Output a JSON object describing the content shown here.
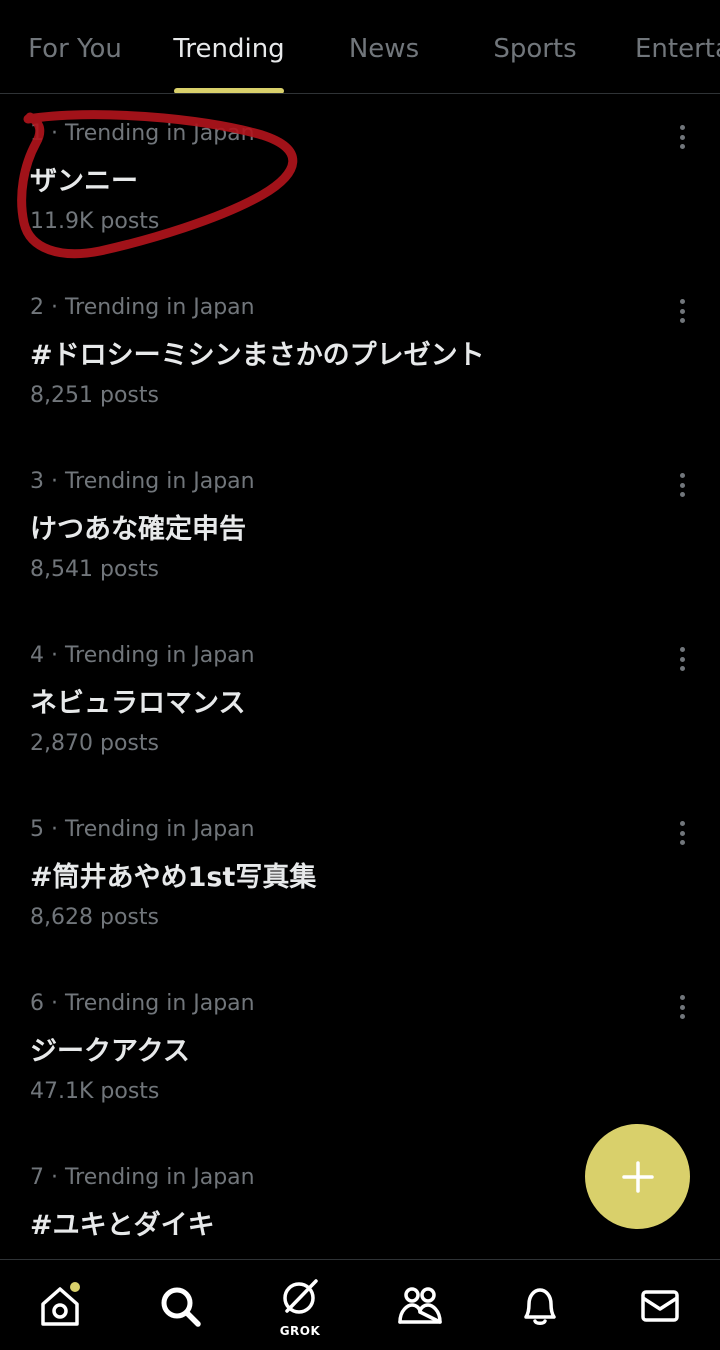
{
  "tabs": [
    {
      "label": "For You",
      "active": false
    },
    {
      "label": "Trending",
      "active": true
    },
    {
      "label": "News",
      "active": false
    },
    {
      "label": "Sports",
      "active": false
    },
    {
      "label": "Entertainment",
      "active": false
    }
  ],
  "trends": [
    {
      "meta": "1 · Trending in Japan",
      "title": "ザンニー",
      "count": "11.9K posts"
    },
    {
      "meta": "2 · Trending in Japan",
      "title": "#ドロシーミシンまさかのプレゼント",
      "count": "8,251 posts"
    },
    {
      "meta": "3 · Trending in Japan",
      "title": "けつあな確定申告",
      "count": "8,541 posts"
    },
    {
      "meta": "4 · Trending in Japan",
      "title": "ネビュラロマンス",
      "count": "2,870 posts"
    },
    {
      "meta": "5 · Trending in Japan",
      "title": "#筒井あやめ1st写真集",
      "count": "8,628 posts"
    },
    {
      "meta": "6 · Trending in Japan",
      "title": "ジークアクス",
      "count": "47.1K posts"
    },
    {
      "meta": "7 · Trending in Japan",
      "title": "#ユキとダイキ",
      "count": ""
    }
  ],
  "bottom_nav": {
    "grok_label": "GROK",
    "icons": [
      "home-icon",
      "search-icon",
      "grok-icon",
      "communities-icon",
      "notifications-icon",
      "messages-icon"
    ]
  },
  "colors": {
    "accent": "#d9d06b",
    "background": "#000000",
    "text_primary": "#e7e9ea",
    "text_secondary": "#71767b",
    "annotation": "#b3141c"
  }
}
